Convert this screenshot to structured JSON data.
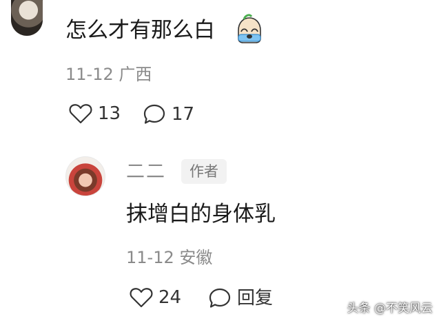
{
  "comment": {
    "text": "怎么才有那么白",
    "emoji_icon": "crying-face-icon",
    "date": "11-12",
    "location": "广西",
    "like_count": "13",
    "reply_count": "17"
  },
  "reply": {
    "username": "二二",
    "badge": "作者",
    "text": "抹增白的身体乳",
    "date": "11-12",
    "location": "安徽",
    "like_count": "24",
    "reply_label": "回复"
  },
  "watermark": "头条 @不笑风云",
  "colors": {
    "text_primary": "#1a1a1a",
    "text_secondary": "#8a8a8a",
    "badge_bg": "#f2f2f2"
  }
}
